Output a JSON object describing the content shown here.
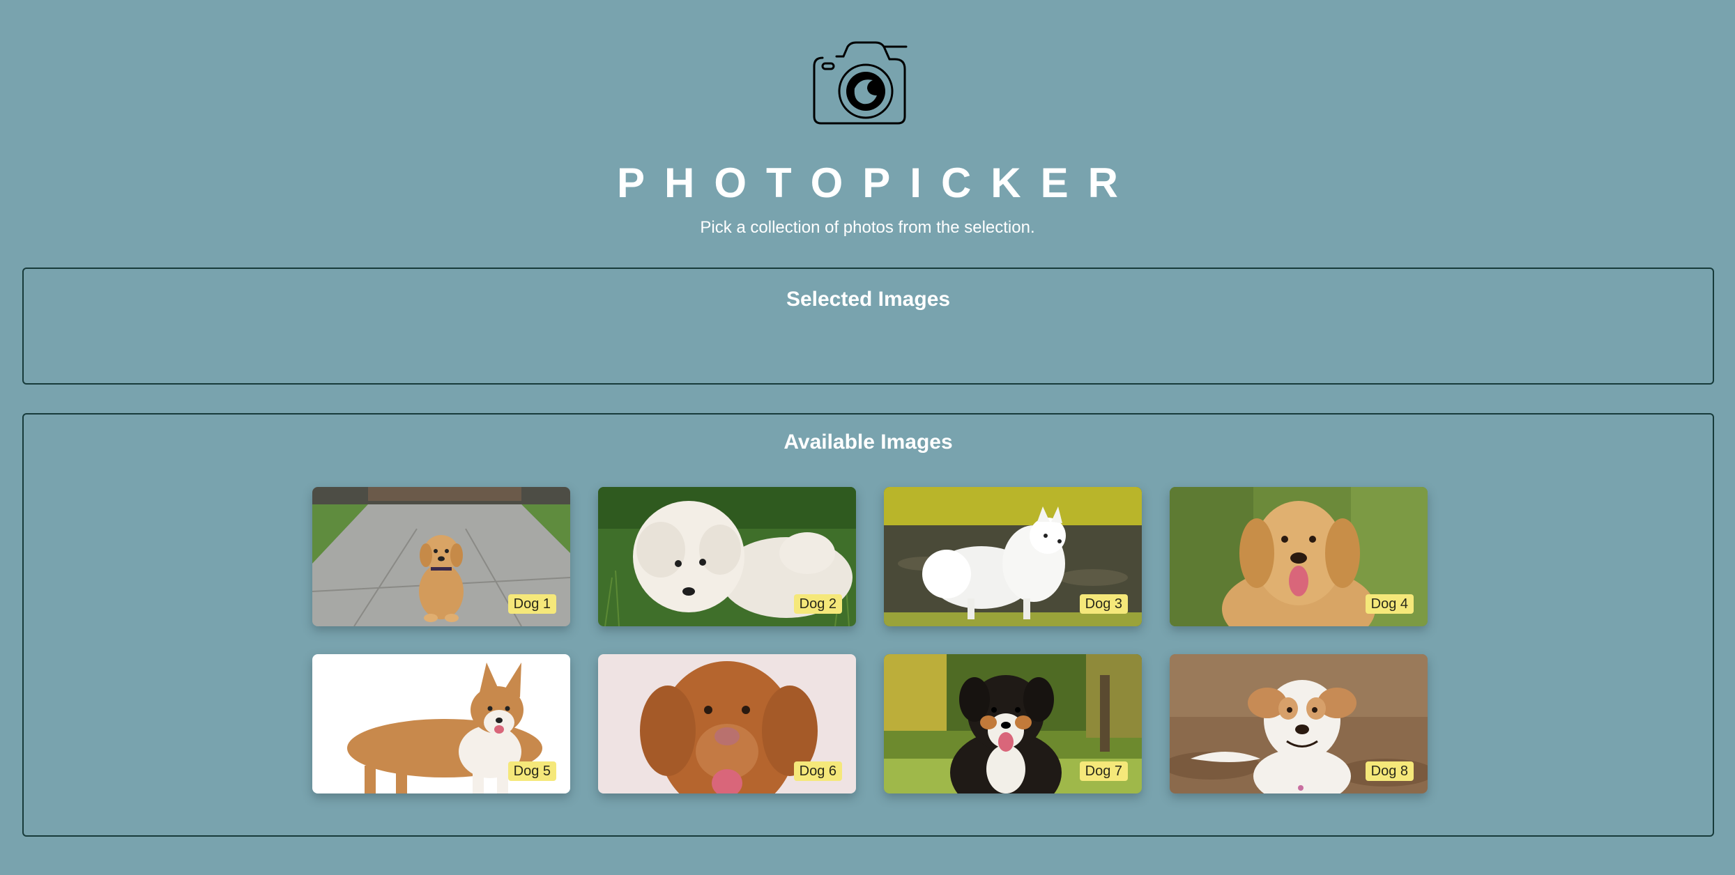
{
  "header": {
    "logo_icon": "camera-icon",
    "title": "PHOTOPICKER",
    "subtitle": "Pick a collection of photos from the selection."
  },
  "selected": {
    "title": "Selected Images",
    "items": []
  },
  "available": {
    "title": "Available Images",
    "items": [
      {
        "label": "Dog 1"
      },
      {
        "label": "Dog 2"
      },
      {
        "label": "Dog 3"
      },
      {
        "label": "Dog 4"
      },
      {
        "label": "Dog 5"
      },
      {
        "label": "Dog 6"
      },
      {
        "label": "Dog 7"
      },
      {
        "label": "Dog 8"
      }
    ]
  },
  "colors": {
    "background": "#79a3ae",
    "border": "#173a3a",
    "badge": "#f5e87a"
  }
}
